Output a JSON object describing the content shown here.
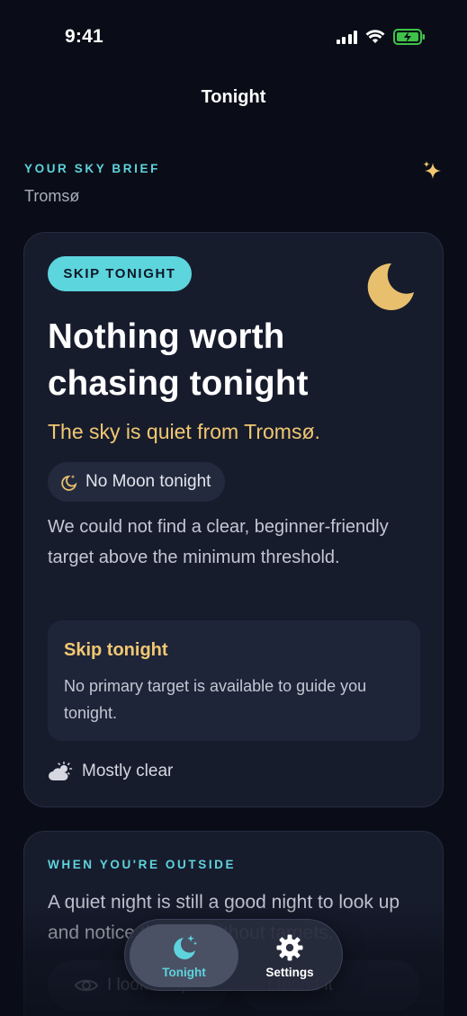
{
  "status_bar": {
    "time": "9:41"
  },
  "nav": {
    "title": "Tonight"
  },
  "header": {
    "eyebrow": "YOUR SKY BRIEF",
    "location": "Tromsø"
  },
  "card": {
    "badge": "SKIP TONIGHT",
    "headline": "Nothing worth chasing tonight",
    "subline": "The sky is quiet from Tromsø.",
    "moon_chip": "No Moon tonight",
    "description": "We could not find a clear, beginner-friendly target above the minimum threshold.",
    "advice": {
      "title": "Skip tonight",
      "body": "No primary target is available to guide you tonight."
    },
    "weather": "Mostly clear"
  },
  "outside_card": {
    "eyebrow": "WHEN YOU'RE OUTSIDE",
    "description": "A quiet night is still a good night to look up and notice the sky without targets.",
    "button_left": "I looked up",
    "button_right": "I found it"
  },
  "tabbar": {
    "tabs": [
      {
        "label": "Tonight",
        "active": true
      },
      {
        "label": "Settings",
        "active": false
      }
    ]
  },
  "colors": {
    "accent_teal": "#5dd5dd",
    "accent_gold": "#f1c871",
    "background": "#0a0d17",
    "card": "#171c2d"
  }
}
